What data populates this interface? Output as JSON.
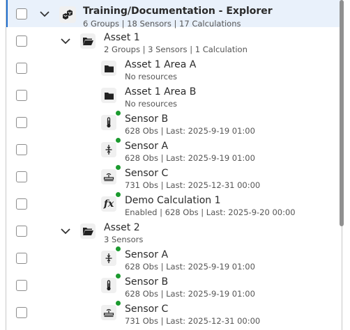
{
  "tree": {
    "root": {
      "name": "Training/Documentation - Explorer",
      "summary": "6 Groups | 18 Sensors | 17 Calculations"
    },
    "asset1": {
      "name": "Asset 1",
      "summary": "2 Groups | 3 Sensors | 1 Calculation",
      "children": [
        {
          "name": "Asset 1 Area A",
          "detail": "No resources",
          "icon": "folder-icon"
        },
        {
          "name": "Asset 1 Area B",
          "detail": "No resources",
          "icon": "folder-icon"
        },
        {
          "name": "Sensor B",
          "detail": "628 Obs | Last: 2025-9-19 01:00",
          "icon": "thermometer-icon",
          "status": "online"
        },
        {
          "name": "Sensor A",
          "detail": "628 Obs | Last: 2025-9-19 01:00",
          "icon": "pressure-gauge-icon",
          "status": "online"
        },
        {
          "name": "Sensor C",
          "detail": "731 Obs | Last: 2025-12-31 00:00",
          "icon": "weather-station-icon",
          "status": "online"
        },
        {
          "name": "Demo Calculation 1",
          "detail": "Enabled | 628 Obs | Last: 2025-9-20 00:00",
          "icon": "fx-function-icon",
          "status": "online"
        }
      ]
    },
    "asset2": {
      "name": "Asset 2",
      "summary": "3 Sensors",
      "children": [
        {
          "name": "Sensor A",
          "detail": "628 Obs | Last: 2025-9-19 01:00",
          "icon": "pressure-gauge-icon",
          "status": "online"
        },
        {
          "name": "Sensor B",
          "detail": "628 Obs | Last: 2025-9-19 01:00",
          "icon": "thermometer-icon",
          "status": "online"
        },
        {
          "name": "Sensor C",
          "detail": "731 Obs | Last: 2025-12-31 00:00",
          "icon": "weather-station-icon",
          "status": "online"
        }
      ]
    }
  },
  "colors": {
    "selected_row_bg": "#e9f1fb",
    "selected_accent": "#1e6fd0",
    "status_online": "#1b9a2e"
  },
  "icons": {
    "fx_glyph": "fx"
  }
}
